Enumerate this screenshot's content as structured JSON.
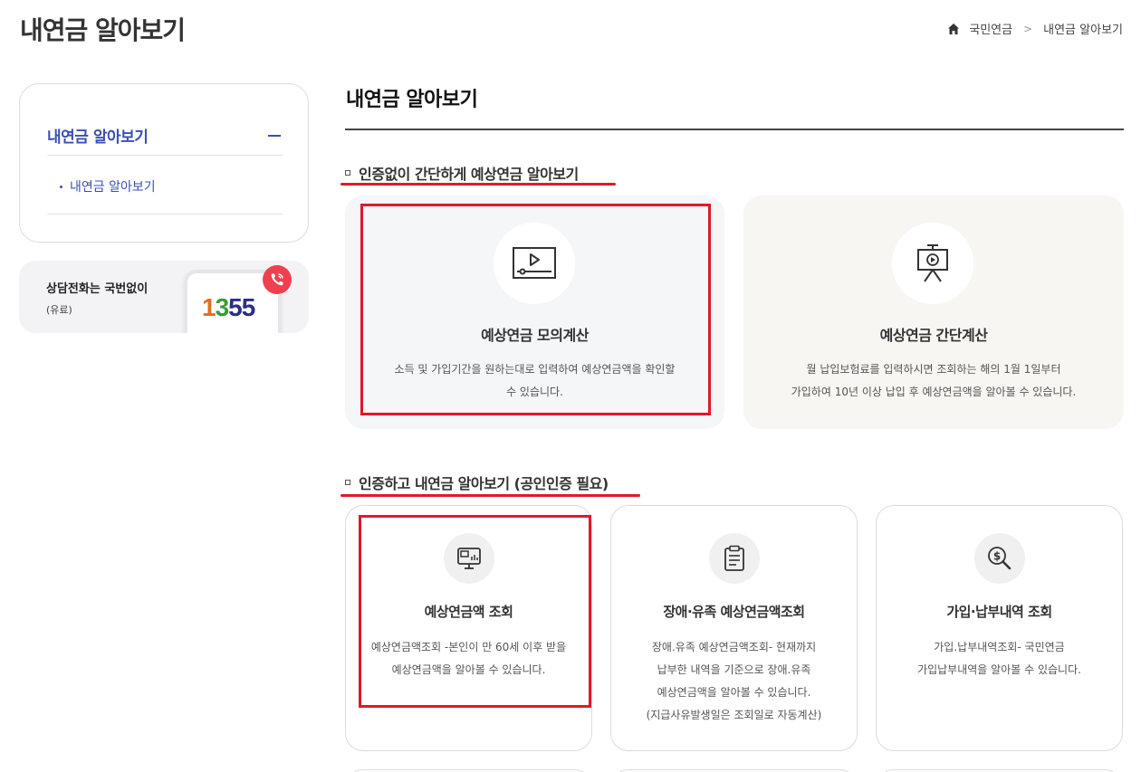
{
  "page": {
    "title": "내연금 알아보기"
  },
  "breadcrumb": {
    "home_icon": "home-icon",
    "items": [
      "국민연금",
      "내연금 알아보기"
    ]
  },
  "sidebar": {
    "menu_title": "내연금 알아보기",
    "sub_items": [
      "내연금 알아보기"
    ],
    "call": {
      "title": "상담전화는 국번없이",
      "sub": "(유료)",
      "number": "1355"
    }
  },
  "main": {
    "title": "내연금 알아보기",
    "section1": {
      "heading": "인증없이 간단하게 예상연금 알아보기",
      "cards": [
        {
          "title": "예상연금 모의계산",
          "icon": "video-player-icon",
          "desc": [
            "소득 및 가입기간을 원하는대로 입력하여 예상연금액을 확인할",
            "수 있습니다."
          ]
        },
        {
          "title": "예상연금 간단계산",
          "icon": "presentation-board-icon",
          "desc": [
            "월 납입보험료를 입력하시면 조회하는 해의 1월 1일부터",
            "가입하여 10년 이상 납입 후 예상연금액을 알아볼 수 있습니다."
          ]
        }
      ]
    },
    "section2": {
      "heading": "인증하고 내연금 알아보기 (공인인증 필요)",
      "cards": [
        {
          "title": "예상연금액 조회",
          "icon": "monitor-chart-icon",
          "desc": [
            "예상연금액조회 -본인이 만 60세 이후 받을",
            "예상연금액을 알아볼 수 있습니다."
          ]
        },
        {
          "title": "장애·유족 예상연금액조회",
          "icon": "clipboard-document-icon",
          "desc": [
            "장애.유족 예상연금액조회- 현재까지",
            "납부한 내역을 기준으로 장애.유족",
            "예상연금액을 알아볼 수 있습니다.",
            "(지급사유발생일은 조회일로 자동계산)"
          ]
        },
        {
          "title": "가입·납부내역 조회",
          "icon": "money-search-icon",
          "desc": [
            "가입.납부내역조회- 국민연금",
            "가입납부내역을 알아볼 수 있습니다."
          ]
        }
      ]
    }
  },
  "colors": {
    "accent_blue": "#3b4fb0",
    "highlight_red": "#e0192a"
  }
}
